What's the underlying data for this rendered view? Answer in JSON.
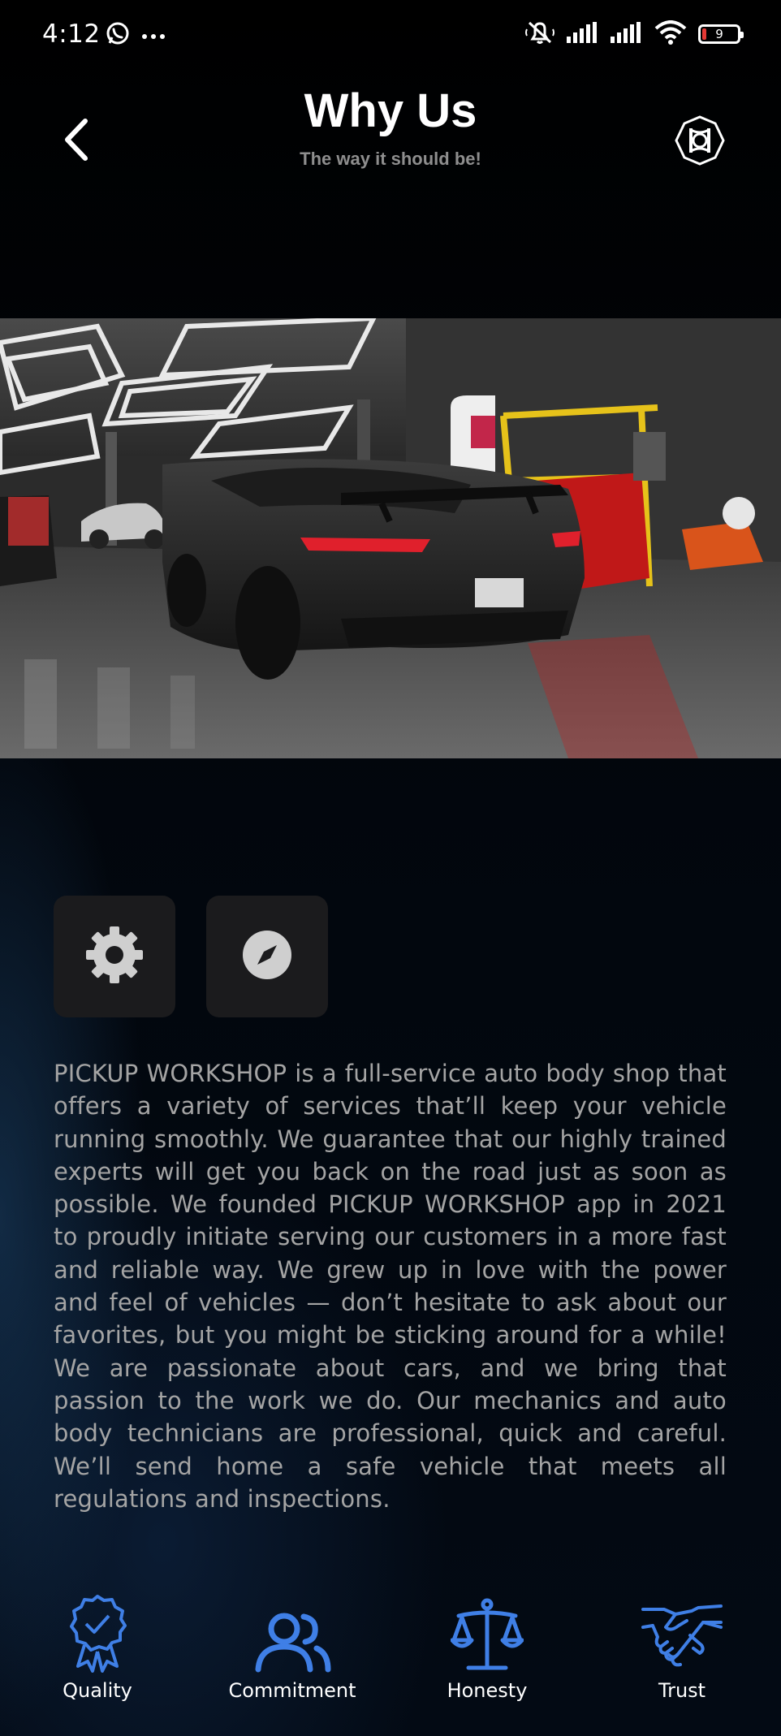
{
  "status_bar": {
    "time": "4:12",
    "battery_level": "9",
    "icons": [
      "whatsapp-icon",
      "more-dots-icon",
      "mute-icon",
      "signal-icon",
      "signal-icon",
      "wifi-icon",
      "battery-icon"
    ]
  },
  "header": {
    "title": "Why Us",
    "subtitle": "The way it should be!",
    "back_icon": "chevron-left-icon",
    "logo_icon": "brand-logo-icon"
  },
  "hero": {
    "description_icon": "workshop-car-photo"
  },
  "actions": [
    {
      "icon": "gear-icon"
    },
    {
      "icon": "compass-icon"
    }
  ],
  "description": "PICKUP WORKSHOP is a full-service auto body shop that offers a variety of services that’ll keep your vehicle running smoothly. We guarantee that our highly trained experts will get you back on the road just as soon as possible. We founded PICKUP WORKSHOP app in 2021 to proudly initiate serving our customers in a more fast and reliable way. We grew up in love with the power and feel of vehicles — don’t hesitate to ask about our favorites, but you might be sticking around for a while! We are passionate about cars, and we bring that passion to the work we do. Our mechanics and auto body technicians are professional, quick and careful. We’ll send home a safe vehicle that meets all regulations and inspections.",
  "values": [
    {
      "label": "Quality",
      "icon": "award-badge-icon"
    },
    {
      "label": "Commitment",
      "icon": "users-icon"
    },
    {
      "label": "Honesty",
      "icon": "scale-icon"
    },
    {
      "label": "Trust",
      "icon": "handshake-icon"
    }
  ],
  "colors": {
    "accent": "#3f7fe6",
    "background": "#000000",
    "text_muted": "#a4a4a4",
    "button_bg": "#1b1b1d"
  }
}
